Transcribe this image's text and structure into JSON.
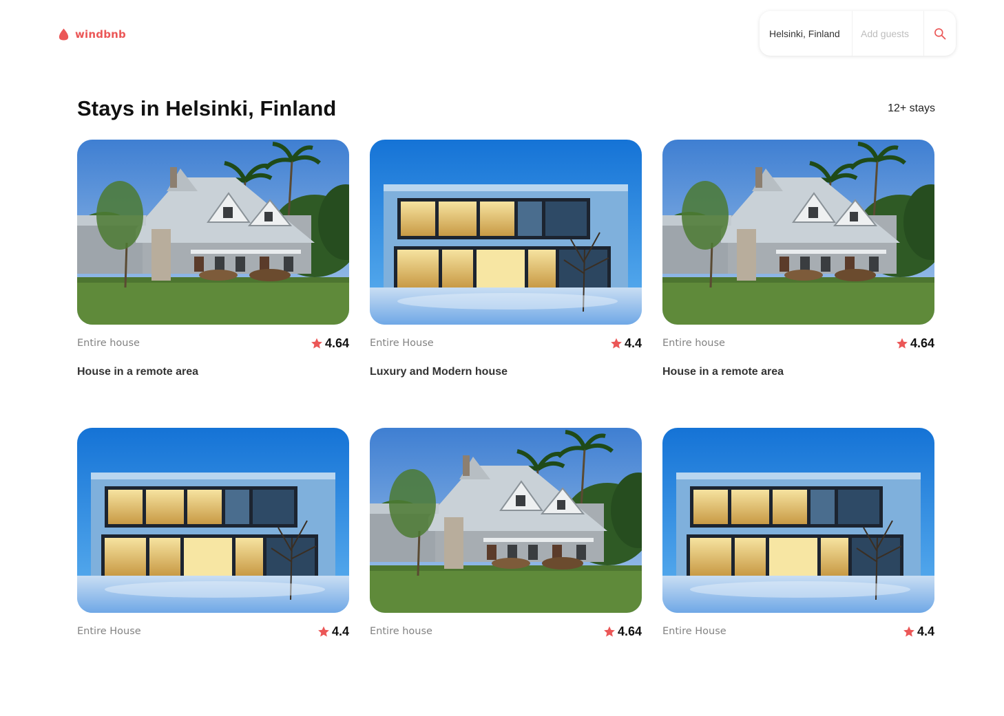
{
  "brand": {
    "name": "windbnb",
    "color": "#eb5757"
  },
  "search": {
    "location": "Helsinki, Finland",
    "guests_placeholder": "Add guests",
    "button_icon": "search-icon"
  },
  "heading": {
    "title": "Stays in Helsinki, Finland",
    "count": "12+ stays"
  },
  "stays": [
    {
      "type": "Entire house",
      "rating": "4.64",
      "title": "House in a remote area",
      "photo": "country-house"
    },
    {
      "type": "Entire House",
      "rating": "4.4",
      "title": "Luxury and Modern house",
      "photo": "modern-house"
    },
    {
      "type": "Entire house",
      "rating": "4.64",
      "title": "House in a remote area",
      "photo": "country-house"
    },
    {
      "type": "Entire House",
      "rating": "4.4",
      "title": "",
      "photo": "modern-house"
    },
    {
      "type": "Entire house",
      "rating": "4.64",
      "title": "",
      "photo": "country-house"
    },
    {
      "type": "Entire House",
      "rating": "4.4",
      "title": "",
      "photo": "modern-house"
    }
  ]
}
